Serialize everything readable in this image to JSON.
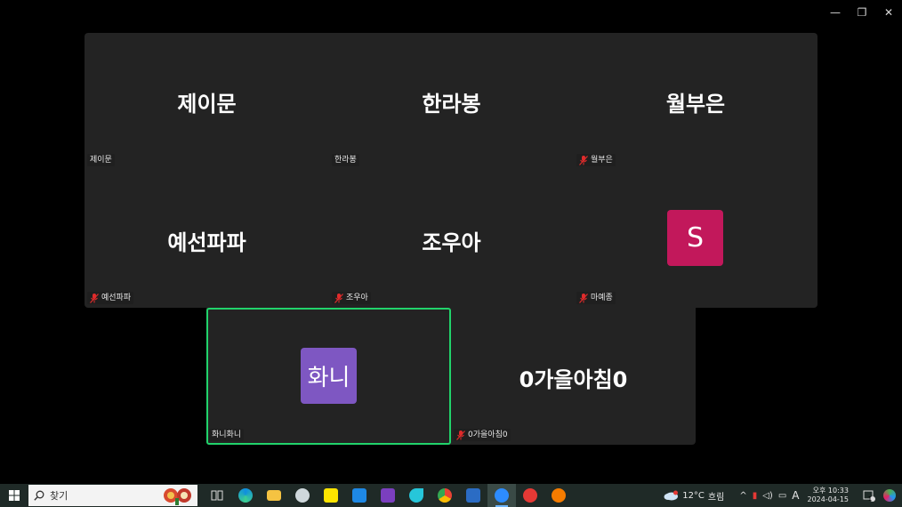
{
  "window": {
    "controls": {
      "minimize": "—",
      "restore": "❐",
      "close": "✕"
    }
  },
  "participants": [
    {
      "display": "제이문",
      "label": "제이문",
      "muted": false
    },
    {
      "display": "한라봉",
      "label": "한라봉",
      "muted": false
    },
    {
      "display": "월부은",
      "label": "월부은",
      "muted": true
    },
    {
      "display": "예선파파",
      "label": "예선파파",
      "muted": true
    },
    {
      "display": "조우아",
      "label": "조우아",
      "muted": true
    },
    {
      "display": "S",
      "label": "마예종",
      "muted": true,
      "avatar": true,
      "avatar_color": "#c2185b"
    },
    {
      "display": "화니",
      "label": "화니화니",
      "muted": false,
      "avatar": true,
      "avatar_color": "#7e57c2",
      "active_speaker": true
    },
    {
      "display": "0가을아침0",
      "label": "0가을아침0",
      "muted": true
    }
  ],
  "taskbar": {
    "search_placeholder": "찾기",
    "weather": {
      "temp": "12°C",
      "condition": "흐림"
    },
    "ime": "A",
    "clock": {
      "time": "오후 10:33",
      "date": "2024-04-15"
    },
    "notification_count": "1"
  },
  "colors": {
    "active_border": "#21d36b",
    "tile_bg": "#232323",
    "taskbar_bg": "#1f2a27"
  }
}
